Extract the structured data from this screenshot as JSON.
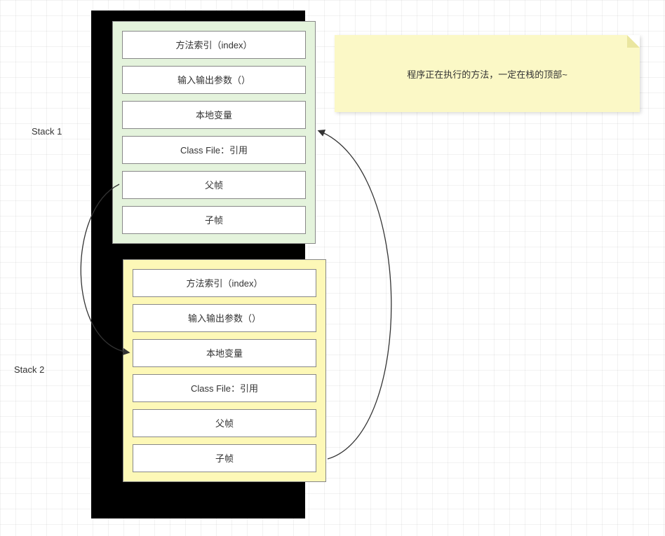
{
  "note": {
    "text": "程序正在执行的方法，一定在栈的顶部~"
  },
  "labels": {
    "stack1": "Stack 1",
    "stack2": "Stack 2"
  },
  "frame1": {
    "rows": [
      "方法索引（index）",
      "输入输出参数（）",
      "本地变量",
      "Class File：引用",
      "父帧",
      "子帧"
    ]
  },
  "frame2": {
    "rows": [
      "方法索引（index）",
      "输入输出参数（）",
      "本地变量",
      "Class File：引用",
      "父帧",
      "子帧"
    ]
  }
}
